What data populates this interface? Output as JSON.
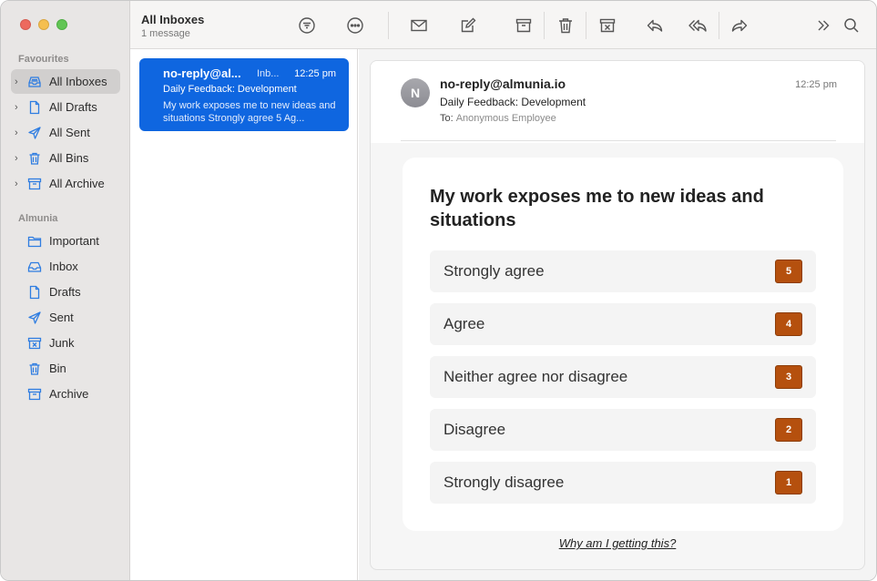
{
  "sidebar": {
    "favourites_label": "Favourites",
    "favourites": [
      {
        "label": "All Inboxes",
        "icon": "all-inboxes-icon",
        "active": true
      },
      {
        "label": "All Drafts",
        "icon": "drafts-icon"
      },
      {
        "label": "All Sent",
        "icon": "sent-icon"
      },
      {
        "label": "All Bins",
        "icon": "bin-icon"
      },
      {
        "label": "All Archive",
        "icon": "archive-icon"
      }
    ],
    "account_label": "Almunia",
    "account_items": [
      {
        "label": "Important",
        "icon": "folder-icon"
      },
      {
        "label": "Inbox",
        "icon": "inbox-icon"
      },
      {
        "label": "Drafts",
        "icon": "drafts-icon"
      },
      {
        "label": "Sent",
        "icon": "sent-icon"
      },
      {
        "label": "Junk",
        "icon": "junk-icon"
      },
      {
        "label": "Bin",
        "icon": "bin-icon"
      },
      {
        "label": "Archive",
        "icon": "archive-icon"
      }
    ]
  },
  "toolbar": {
    "title": "All Inboxes",
    "subtitle": "1 message"
  },
  "message": {
    "from": "no-reply@al...",
    "mailbox": "Inb...",
    "time": "12:25 pm",
    "subject": "Daily Feedback: Development",
    "preview": "My work exposes me to new ideas and situations Strongly agree 5 Ag..."
  },
  "email": {
    "avatar_initial": "N",
    "from": "no-reply@almunia.io",
    "time": "12:25 pm",
    "subject": "Daily Feedback: Development",
    "to_label": "To:",
    "to_name": "Anonymous Employee",
    "question": "My work exposes me to new ideas and situations",
    "options": [
      {
        "label": "Strongly agree",
        "value": "5"
      },
      {
        "label": "Agree",
        "value": "4"
      },
      {
        "label": "Neither agree nor disagree",
        "value": "3"
      },
      {
        "label": "Disagree",
        "value": "2"
      },
      {
        "label": "Strongly disagree",
        "value": "1"
      }
    ],
    "why_link": "Why am I getting this?"
  },
  "colors": {
    "accent": "#0f66e0",
    "badge": "#b5500e",
    "sidebar_icon": "#2f7de1"
  }
}
